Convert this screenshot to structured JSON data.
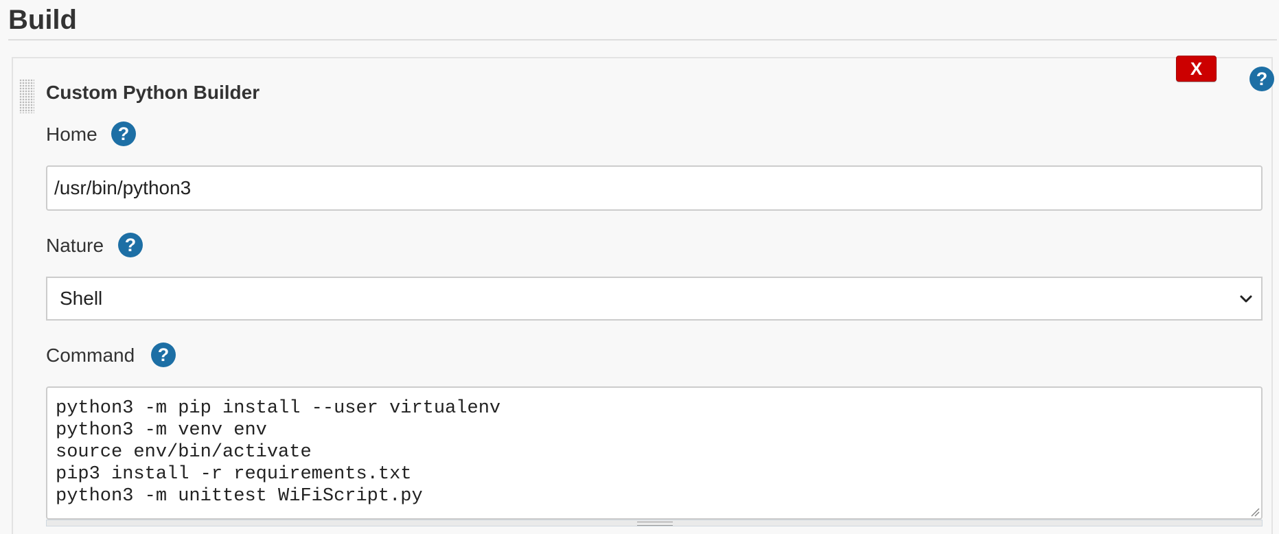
{
  "section": {
    "title": "Build"
  },
  "builder": {
    "title": "Custom Python Builder",
    "delete_label": "X",
    "help_glyph": "?",
    "icons": {
      "help": "help-icon",
      "drag": "drag-handle-icon",
      "dropdown": "chevron-down-icon",
      "resize": "resize-grip-icon"
    },
    "colors": {
      "delete_button": "#cc0000",
      "help_icon": "#1d6fa5"
    }
  },
  "fields": {
    "home": {
      "label": "Home",
      "value": "/usr/bin/python3"
    },
    "nature": {
      "label": "Nature",
      "selected": "Shell"
    },
    "command": {
      "label": "Command",
      "lines": [
        "python3 -m pip install --user virtualenv",
        "python3 -m venv env",
        "source env/bin/activate",
        "pip3 install -r requirements.txt",
        "python3 -m unittest WiFiScript.py"
      ]
    }
  }
}
